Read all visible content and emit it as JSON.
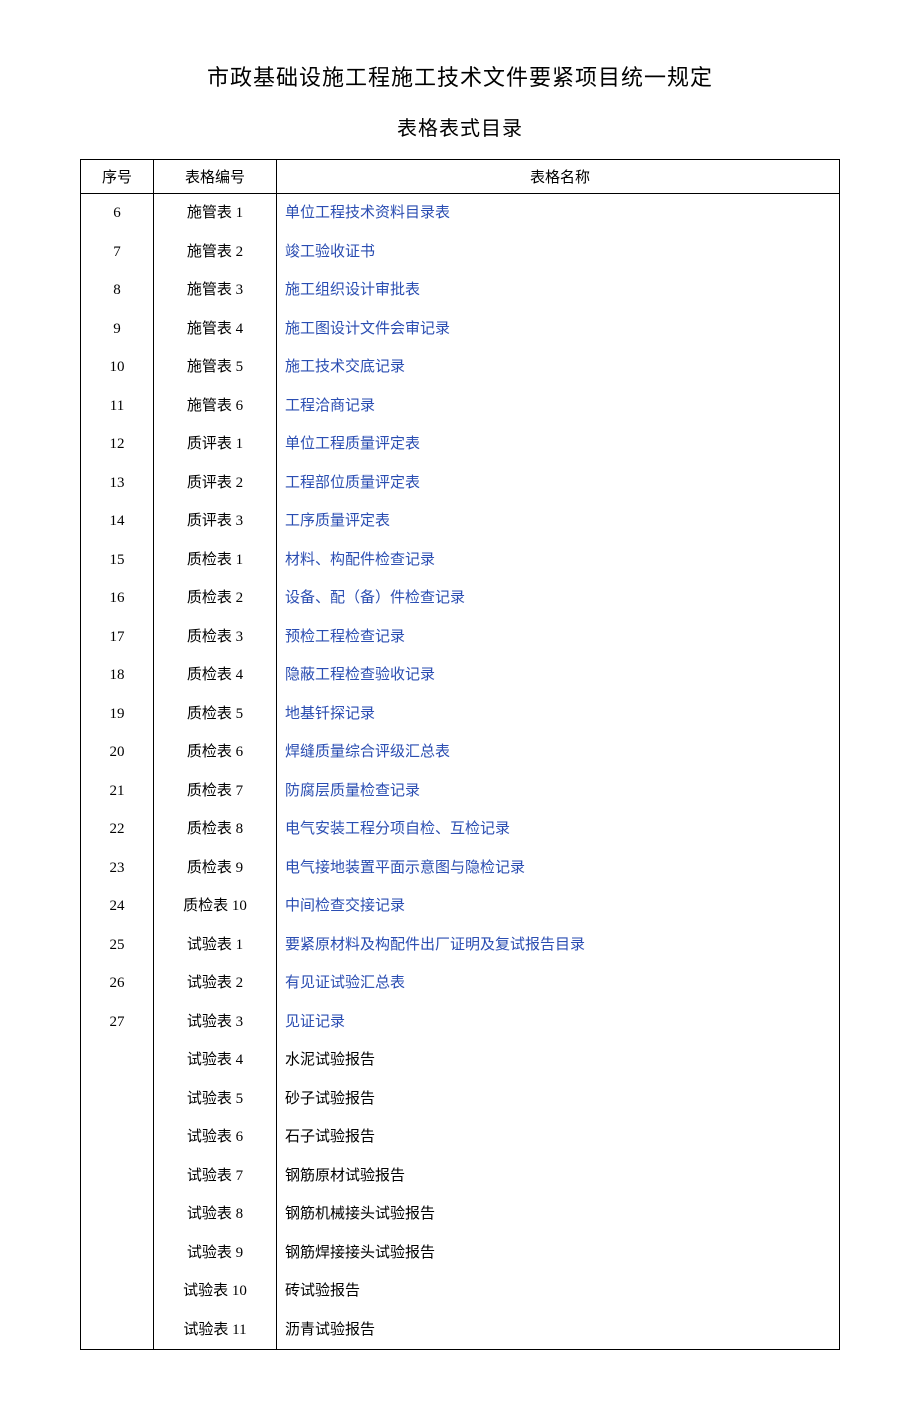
{
  "title1": "市政基础设施工程施工技术文件要紧项目统一规定",
  "title2": "表格表式目录",
  "headers": {
    "seq": "序号",
    "code": "表格编号",
    "name": "表格名称"
  },
  "rows": [
    {
      "seq": "6",
      "code": "施管表 1",
      "name": "单位工程技术资料目录表",
      "link": true
    },
    {
      "seq": "7",
      "code": "施管表 2",
      "name": "竣工验收证书",
      "link": true
    },
    {
      "seq": "8",
      "code": "施管表 3",
      "name": "施工组织设计审批表",
      "link": true
    },
    {
      "seq": "9",
      "code": "施管表 4",
      "name": "施工图设计文件会审记录",
      "link": true
    },
    {
      "seq": "10",
      "code": "施管表 5",
      "name": "施工技术交底记录",
      "link": true
    },
    {
      "seq": "11",
      "code": "施管表 6",
      "name": "工程洽商记录",
      "link": true
    },
    {
      "seq": "12",
      "code": "质评表 1",
      "name": "单位工程质量评定表",
      "link": true
    },
    {
      "seq": "13",
      "code": "质评表 2",
      "name": "工程部位质量评定表",
      "link": true
    },
    {
      "seq": "14",
      "code": "质评表 3",
      "name": "工序质量评定表",
      "link": true
    },
    {
      "seq": "15",
      "code": "质检表 1",
      "name": "材料、构配件检查记录",
      "link": true
    },
    {
      "seq": "16",
      "code": "质检表 2",
      "name": "设备、配（备）件检查记录",
      "link": true
    },
    {
      "seq": "17",
      "code": "质检表 3",
      "name": "预检工程检查记录",
      "link": true
    },
    {
      "seq": "18",
      "code": "质检表 4",
      "name": "隐蔽工程检查验收记录",
      "link": true
    },
    {
      "seq": "19",
      "code": "质检表 5",
      "name": "地基钎探记录",
      "link": true
    },
    {
      "seq": "20",
      "code": "质检表 6",
      "name": "焊缝质量综合评级汇总表",
      "link": true
    },
    {
      "seq": "21",
      "code": "质检表 7",
      "name": "防腐层质量检查记录",
      "link": true
    },
    {
      "seq": "22",
      "code": "质检表 8",
      "name": "电气安装工程分项自检、互检记录",
      "link": true
    },
    {
      "seq": "23",
      "code": "质检表 9",
      "name": "电气接地装置平面示意图与隐检记录",
      "link": true
    },
    {
      "seq": "24",
      "code": "质检表 10",
      "name": "中间检查交接记录",
      "link": true
    },
    {
      "seq": "25",
      "code": "试验表 1",
      "name": "要紧原材料及构配件出厂证明及复试报告目录",
      "link": true
    },
    {
      "seq": "26",
      "code": "试验表 2",
      "name": "有见证试验汇总表",
      "link": true
    },
    {
      "seq": "27",
      "code": "试验表 3",
      "name": "见证记录",
      "link": true
    },
    {
      "seq": "",
      "code": "试验表 4",
      "name": "水泥试验报告",
      "link": false
    },
    {
      "seq": "",
      "code": "试验表 5",
      "name": "砂子试验报告",
      "link": false
    },
    {
      "seq": "",
      "code": "试验表 6",
      "name": "石子试验报告",
      "link": false
    },
    {
      "seq": "",
      "code": "试验表 7",
      "name": "钢筋原材试验报告",
      "link": false
    },
    {
      "seq": "",
      "code": "试验表 8",
      "name": "钢筋机械接头试验报告",
      "link": false
    },
    {
      "seq": "",
      "code": "试验表 9",
      "name": "钢筋焊接接头试验报告",
      "link": false
    },
    {
      "seq": "",
      "code": "试验表 10",
      "name": "砖试验报告",
      "link": false
    },
    {
      "seq": "",
      "code": "试验表 11",
      "name": "沥青试验报告",
      "link": false
    }
  ]
}
